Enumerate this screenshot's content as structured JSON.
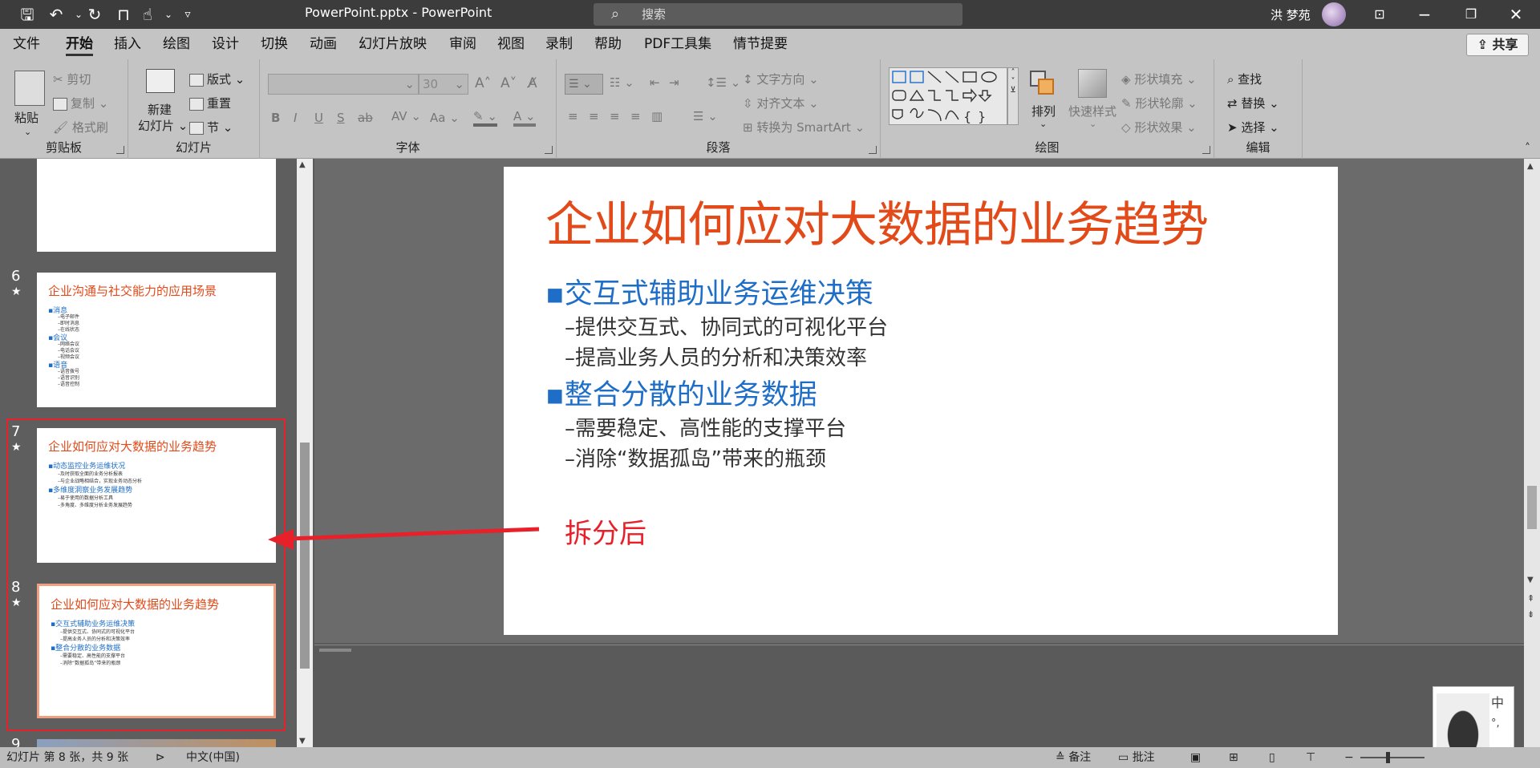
{
  "titlebar": {
    "filename": "PowerPoint.pptx",
    "separator": "-",
    "app": "PowerPoint",
    "search_placeholder": "搜索",
    "user": "洪 梦苑"
  },
  "menu": {
    "tabs": [
      "文件",
      "开始",
      "插入",
      "绘图",
      "设计",
      "切换",
      "动画",
      "幻灯片放映",
      "审阅",
      "视图",
      "录制",
      "帮助",
      "PDF工具集",
      "情节提要"
    ],
    "active": "开始",
    "share": "共享"
  },
  "ribbon": {
    "clipboard": {
      "label": "剪贴板",
      "paste": "粘贴",
      "cut": "剪切",
      "copy": "复制",
      "format_painter": "格式刷"
    },
    "slides": {
      "label": "幻灯片",
      "new_slide_1": "新建",
      "new_slide_2": "幻灯片",
      "layout": "版式",
      "reset": "重置",
      "section": "节"
    },
    "font": {
      "label": "字体",
      "size": "30"
    },
    "paragraph": {
      "label": "段落",
      "text_direction": "文字方向",
      "align_text": "对齐文本",
      "smartart": "转换为 SmartArt"
    },
    "drawing": {
      "label": "绘图",
      "arrange": "排列",
      "quick_styles": "快速样式",
      "fill": "形状填充",
      "outline": "形状轮廓",
      "effects": "形状效果"
    },
    "editing": {
      "label": "编辑",
      "find": "查找",
      "replace": "替换",
      "select": "选择"
    }
  },
  "thumbnails": [
    {
      "num": "6",
      "title": "企业沟通与社交能力的应用场景",
      "bullets": [
        {
          "l": 1,
          "t": "▪消息"
        },
        {
          "l": 2,
          "t": "–电子邮件"
        },
        {
          "l": 2,
          "t": "–即时消息"
        },
        {
          "l": 2,
          "t": "–在线状态"
        },
        {
          "l": 1,
          "t": "▪会议"
        },
        {
          "l": 2,
          "t": "–网络会议"
        },
        {
          "l": 2,
          "t": "–电话会议"
        },
        {
          "l": 2,
          "t": "–视频会议"
        },
        {
          "l": 1,
          "t": "▪语音"
        },
        {
          "l": 2,
          "t": "–语音拨号"
        },
        {
          "l": 2,
          "t": "–语音识别"
        },
        {
          "l": 2,
          "t": "–语音控制"
        }
      ]
    },
    {
      "num": "7",
      "title": "企业如何应对大数据的业务趋势",
      "bullets": [
        {
          "l": 1,
          "t": "▪动态监控业务运维状况"
        },
        {
          "l": 2,
          "t": "–及时获取全面的业务分析报表"
        },
        {
          "l": 2,
          "t": "–与企业战略相结合，实现业务动态分析"
        },
        {
          "l": 1,
          "t": "▪多维度洞察业务发展趋势"
        },
        {
          "l": 2,
          "t": "–易于使用的数据分析工具"
        },
        {
          "l": 2,
          "t": "–多角度、多维度分析业务发展趋势"
        }
      ]
    },
    {
      "num": "8",
      "title": "企业如何应对大数据的业务趋势",
      "bullets": [
        {
          "l": 1,
          "t": "▪交互式辅助业务运维决策"
        },
        {
          "l": 2,
          "t": "–提供交互式、协同式的可视化平台"
        },
        {
          "l": 2,
          "t": "–提高业务人员的分析和决策效率"
        },
        {
          "l": 1,
          "t": "▪整合分散的业务数据"
        },
        {
          "l": 2,
          "t": "–需要稳定、高性能的支撑平台"
        },
        {
          "l": 2,
          "t": "–消除“数据孤岛”带来的瓶颈"
        }
      ]
    },
    {
      "num": "9"
    }
  ],
  "slide": {
    "title": "企业如何应对大数据的业务趋势",
    "b1": "▪交互式辅助业务运维决策",
    "b1a": "–提供交互式、协同式的可视化平台",
    "b1b": "–提高业务人员的分析和决策效率",
    "b2": "▪整合分散的业务数据",
    "b2a": "–需要稳定、高性能的支撑平台",
    "b2b": "–消除“数据孤岛”带来的瓶颈",
    "annotation": "拆分后"
  },
  "statusbar": {
    "slide_info": "幻灯片 第 8 张，共 9 张",
    "language": "中文(中国)",
    "notes": "备注",
    "comments": "批注"
  },
  "ime": {
    "lang": "中",
    "punct": "°,"
  },
  "colors": {
    "title_red": "#e34a1a",
    "bullet_blue": "#1e6ec8",
    "arrow_red": "#e8202a"
  }
}
